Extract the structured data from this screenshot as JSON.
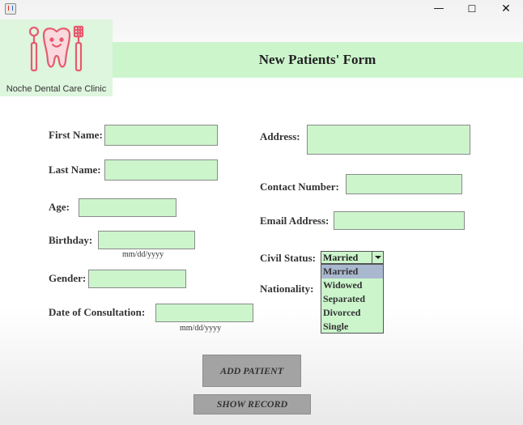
{
  "window": {
    "minimize_symbol": "—",
    "maximize_symbol": "☐",
    "close_symbol": "✕"
  },
  "brand": {
    "clinic_name": "Noche Dental Care Clinic",
    "logo_icon": "tooth-with-dental-tools-icon",
    "logo_color": "#e85a6e"
  },
  "header": {
    "title": "New Patients' Form"
  },
  "colors": {
    "field_bg": "#ccf5cc",
    "banner_bg": "#ccf5cc",
    "button_bg": "#a3a3a3",
    "selected_option_bg": "#a9b7cf"
  },
  "form": {
    "first_name": {
      "label": "First Name:",
      "value": ""
    },
    "last_name": {
      "label": "Last Name:",
      "value": ""
    },
    "age": {
      "label": "Age:",
      "value": ""
    },
    "birthday": {
      "label": "Birthday:",
      "value": "",
      "hint": "mm/dd/yyyy"
    },
    "gender": {
      "label": "Gender:",
      "value": ""
    },
    "consultation_date": {
      "label": "Date of Consultation:",
      "value": "",
      "hint": "mm/dd/yyyy"
    },
    "address": {
      "label": "Address:",
      "value": ""
    },
    "contact_number": {
      "label": "Contact Number:",
      "value": ""
    },
    "email": {
      "label": "Email Address:",
      "value": ""
    },
    "civil_status": {
      "label": "Civil Status:",
      "selected": "Married",
      "options": [
        "Married",
        "Widowed",
        "Separated",
        "Divorced",
        "Single"
      ]
    },
    "nationality": {
      "label": "Nationality:"
    }
  },
  "buttons": {
    "add_patient": "ADD PATIENT",
    "show_record": "SHOW RECORD"
  }
}
